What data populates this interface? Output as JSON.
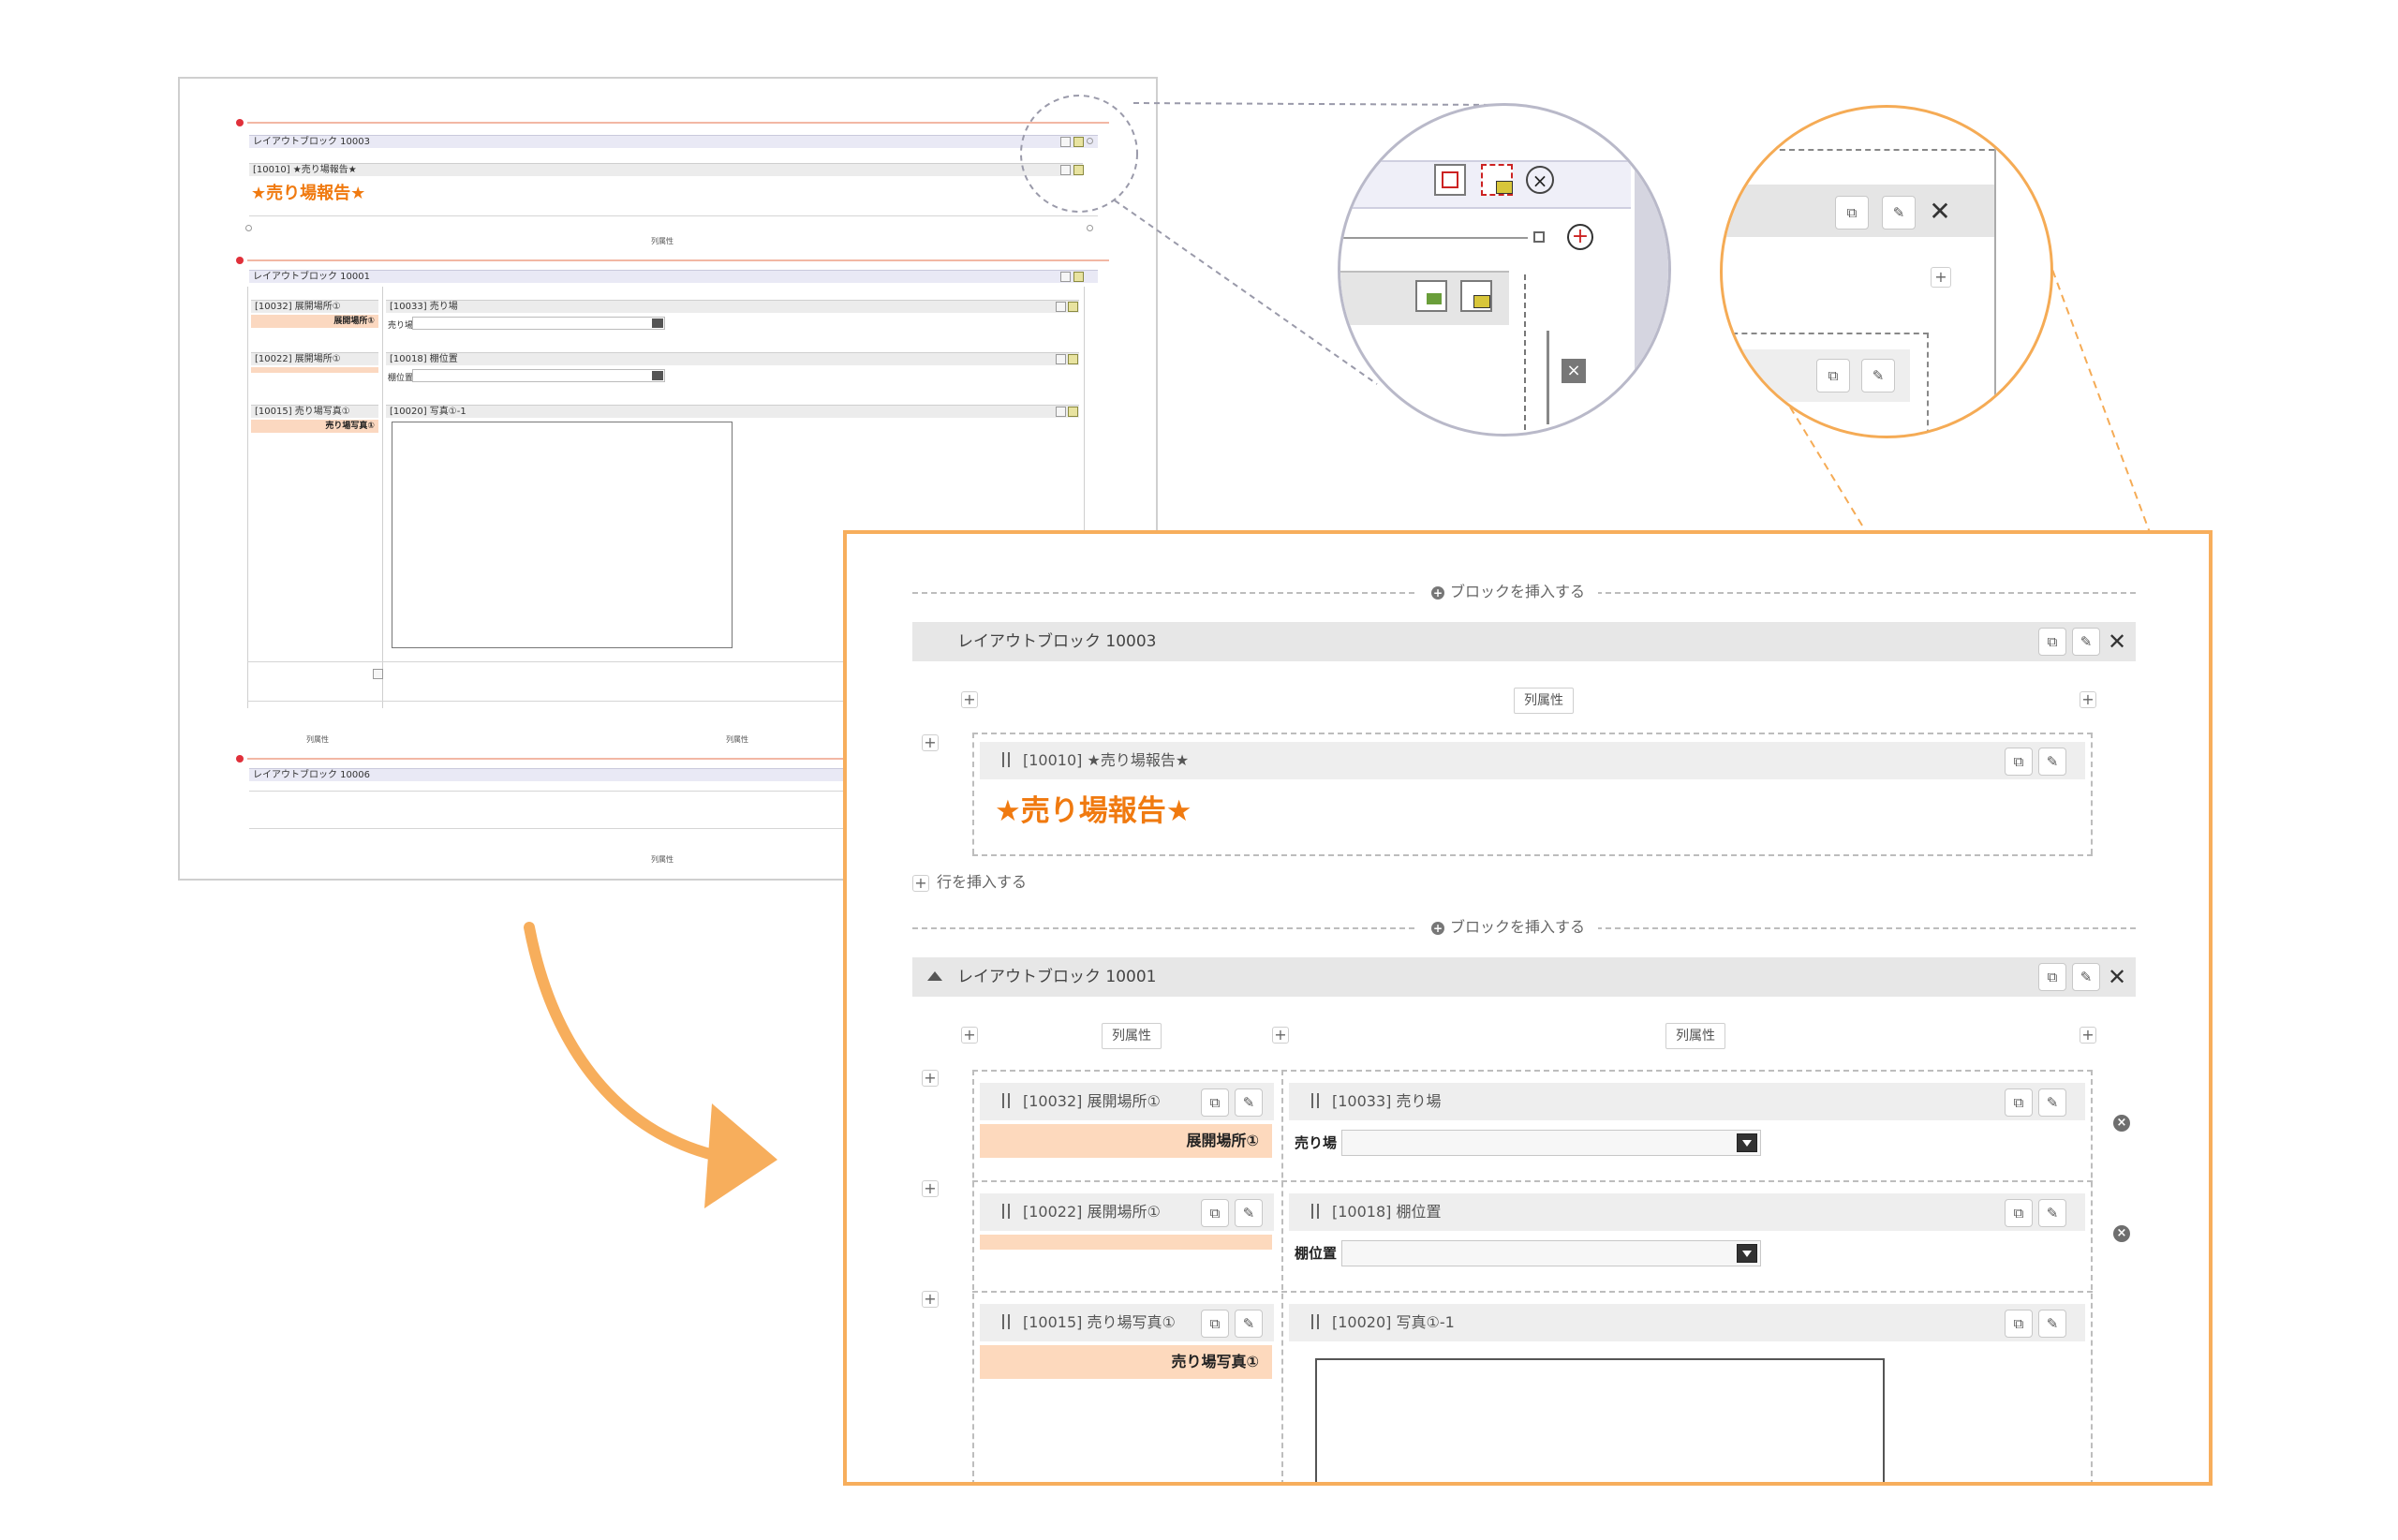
{
  "old_ui": {
    "block1_title": "レイアウトブロック 10003",
    "field_10010": "[10010] ★売り場報告★",
    "report_title": "★売り場報告★",
    "col_attr": "列属性",
    "block2_title": "レイアウトブロック 10001",
    "field_10032": "[10032] 展開場所①",
    "peach_10032": "展開場所①",
    "field_10033": "[10033] 売り場",
    "label_10033": "売り場",
    "field_10022": "[10022] 展開場所①",
    "field_10018": "[10018] 棚位置",
    "label_10018": "棚位置",
    "field_10015": "[10015] 売り場写真①",
    "peach_10015": "売り場写真①",
    "field_10020": "[10020] 写真①-1",
    "block3_title": "レイアウトブロック 10006"
  },
  "new_ui": {
    "insert_block": "ブロックを挿入する",
    "insert_row": "行を挿入する",
    "col_attr": "列属性",
    "block1": {
      "title": "レイアウトブロック 10003",
      "field_title": "[10010] ★売り場報告★",
      "report_title": "★売り場報告★"
    },
    "block2": {
      "title": "レイアウトブロック 10001",
      "rows": [
        {
          "left_title": "[10032] 展開場所①",
          "left_peach": "展開場所①",
          "right_title": "[10033] 売り場",
          "right_label": "売り場"
        },
        {
          "left_title": "[10022] 展開場所①",
          "left_peach": "",
          "right_title": "[10018] 棚位置",
          "right_label": "棚位置"
        },
        {
          "left_title": "[10015] 売り場写真①",
          "left_peach": "売り場写真①",
          "right_title": "[10020] 写真①-1",
          "right_label": ""
        }
      ]
    }
  },
  "icons": {
    "copy": "copy-icon",
    "edit": "pencil-icon",
    "close": "close-icon",
    "collapse": "triangle-up-icon",
    "plus": "plus-icon",
    "delete": "delete-circle-icon"
  },
  "colors": {
    "accent_orange": "#f7ae5c",
    "title_orange": "#f07a10",
    "peach": "#fdd9bd",
    "bar_grey": "#e7e7e7"
  }
}
